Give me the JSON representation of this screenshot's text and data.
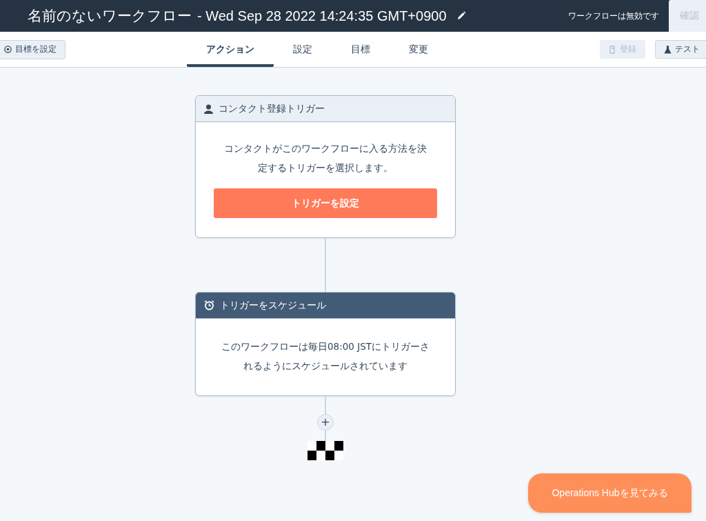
{
  "header": {
    "title": "名前のないワークフロー",
    "subtitle": "- Wed Sep 28 2022 14:24:35 GMT+0900",
    "status": "ワークフローは無効です",
    "confirm_button": "確認"
  },
  "toolbar": {
    "goal_button": "目標を設定",
    "tabs": [
      {
        "label": "アクション",
        "selected": true
      },
      {
        "label": "設定",
        "selected": false
      },
      {
        "label": "目標",
        "selected": false
      },
      {
        "label": "変更",
        "selected": false
      }
    ],
    "buttons": [
      {
        "label": "登録",
        "kind": "enroll",
        "disabled": true
      },
      {
        "label": "テスト",
        "kind": "test",
        "disabled": false
      }
    ]
  },
  "nodes": [
    {
      "kind": "trigger",
      "title": "コンタクト登録トリガー",
      "text": "コンタクトがこのワークフローに入る方法を決定するトリガーを選択します。",
      "button": "トリガーを設定"
    },
    {
      "kind": "schedule",
      "title": "トリガーをスケジュール",
      "text": "このワークフローは毎日08:00 JSTにトリガーされるようにスケジュールされています"
    }
  ],
  "add_button": "+",
  "promo_button": "Operations Hubを見てみる"
}
